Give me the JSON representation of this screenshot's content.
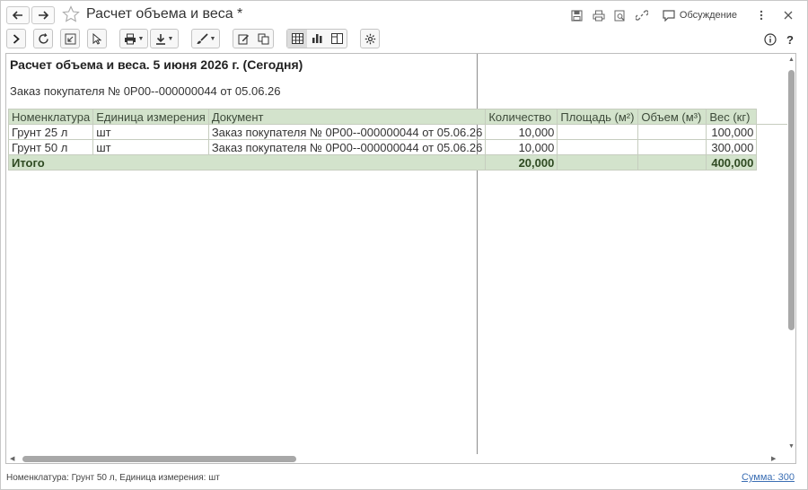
{
  "window": {
    "title": "Расчет объема и веса *",
    "discuss_label": "Обсуждение"
  },
  "toolbar": {
    "help_label": "?"
  },
  "report": {
    "title": "Расчет объема и веса. 5 июня 2026 г. (Сегодня)",
    "subtitle": "Заказ покупателя № 0Р00--000000044 от 05.06.26",
    "columns": [
      "Номенклатура",
      "Единица измерения",
      "Документ",
      "Количество",
      "Площадь (м²)",
      "Объем (м³)",
      "Вес (кг)"
    ],
    "rows": [
      {
        "item": "Грунт 25 л",
        "unit": "шт",
        "doc": "Заказ покупателя № 0Р00--000000044 от 05.06.26",
        "qty": "10,000",
        "area": "",
        "volume": "",
        "weight": "100,000"
      },
      {
        "item": "Грунт 50 л",
        "unit": "шт",
        "doc": "Заказ покупателя № 0Р00--000000044 от 05.06.26",
        "qty": "10,000",
        "area": "",
        "volume": "",
        "weight": "300,000"
      }
    ],
    "total": {
      "label": "Итого",
      "qty": "20,000",
      "area": "",
      "volume": "",
      "weight": "400,000"
    }
  },
  "status": {
    "left": "Номенклатура: Грунт 50 л, Единица измерения: шт",
    "sum_link": "Сумма: 300"
  },
  "colors": {
    "header_bg": "#d3e3cc",
    "link": "#3c6fb4",
    "active_seg": "#dcdcdc"
  }
}
